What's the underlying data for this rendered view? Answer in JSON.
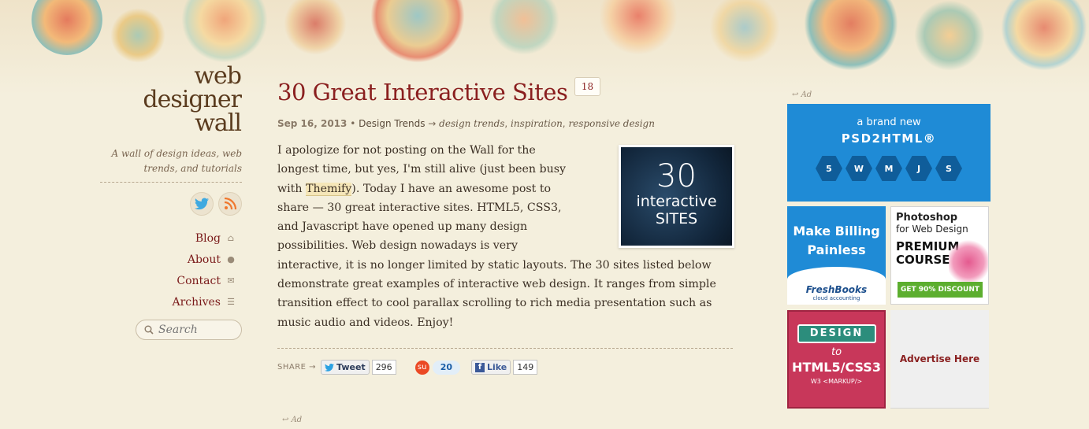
{
  "site": {
    "logo_lines": [
      "web",
      "designer",
      "wall"
    ],
    "tagline": "A wall of design ideas, web trends, and tutorials"
  },
  "social": [
    {
      "name": "twitter",
      "icon": "twitter-bird-icon",
      "color": "#3fa9e0"
    },
    {
      "name": "rss",
      "icon": "rss-icon",
      "color": "#f0782e"
    }
  ],
  "nav": [
    {
      "label": "Blog",
      "icon": "home-icon"
    },
    {
      "label": "About",
      "icon": "user-icon"
    },
    {
      "label": "Contact",
      "icon": "envelope-icon"
    },
    {
      "label": "Archives",
      "icon": "list-icon"
    }
  ],
  "search": {
    "placeholder": "Search"
  },
  "post": {
    "title": "30 Great Interactive Sites",
    "comment_count": "18",
    "date": "Sep 16, 2013",
    "category": "Design Trends",
    "tags": [
      "design trends",
      "inspiration",
      "responsive design"
    ],
    "body_pre": "I apologize for not posting on the Wall for the longest time, but yes, I'm still alive (just been busy with ",
    "body_link": "Themify",
    "body_post": "). Today I have an awesome post to share — 30 great interactive sites. HTML5, CSS3, and Javascript have opened up many design possibilities. Web design nowadays is very interactive, it is no longer limited by static layouts. The 30 sites listed below demonstrate great examples of interactive web design. It ranges from simple transition effect to cool parallax scrolling to rich media presentation such as music audio and videos. Enjoy!",
    "thumb": {
      "number": "30",
      "word1": "interactive",
      "word2": "SITES"
    }
  },
  "share": {
    "label": "SHARE →",
    "tweet_label": "Tweet",
    "tweet_count": "296",
    "stumble_count": "20",
    "like_label": "Like",
    "like_count": "149"
  },
  "ad_marker": "Ad",
  "ads": {
    "psd": {
      "sub": "a brand new",
      "brand": "PSD2HTML®",
      "hexes": [
        "5",
        "W",
        "M",
        "J",
        "S"
      ]
    },
    "freshbooks": {
      "line1": "Make Billing",
      "line2": "Painless",
      "logo": "FreshBooks",
      "logo_sub": "cloud accounting"
    },
    "photoshop": {
      "line1": "Photoshop",
      "line2": "for Web Design",
      "line3": "PREMIUM",
      "line4": "COURSE",
      "cta": "GET 90% DISCOUNT"
    },
    "d2h": {
      "ribbon": "DESIGN",
      "to": "to",
      "big": "HTML5/CSS3",
      "small": "W3 <MARKUP/>"
    },
    "placeholder": "Advertise Here"
  },
  "colors": {
    "accent": "#8a1f1f",
    "ad_blue": "#1f8bd6"
  }
}
